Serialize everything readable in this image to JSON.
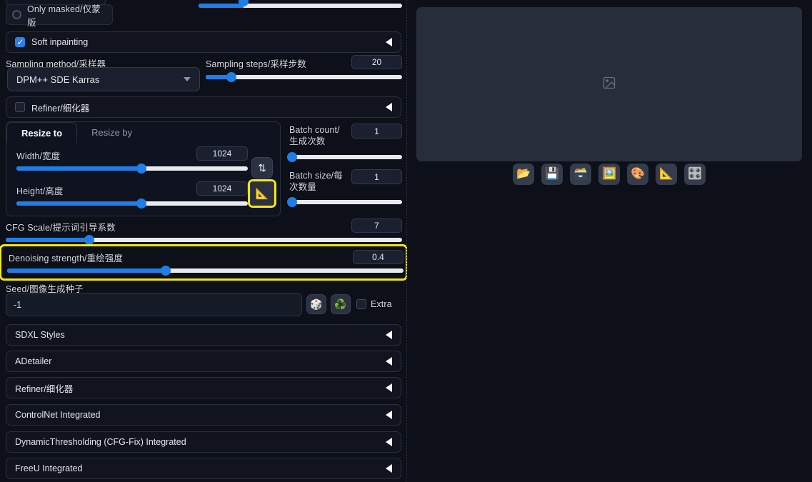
{
  "app": {
    "theme_bg": "#0b0d16",
    "accent": "#1f7fe8",
    "highlight": "#f5e712"
  },
  "left": {
    "only_masked": {
      "label": "Only masked/仅蒙版",
      "selected": false
    },
    "soft_inpainting": {
      "label": "Soft inpainting",
      "checked": true,
      "arrow": "◀"
    },
    "sampling_method": {
      "label": "Sampling method/采样器",
      "value": "DPM++ SDE Karras"
    },
    "sampling_steps": {
      "label": "Sampling steps/采样步数",
      "value": "20",
      "min": 1,
      "max": 150,
      "pct": 13
    },
    "refiner": {
      "label": "Refiner/细化器",
      "checked": false,
      "arrow": "◀"
    },
    "resize": {
      "tabs": [
        {
          "label": "Resize to",
          "active": true
        },
        {
          "label": "Resize by",
          "active": false
        }
      ],
      "width": {
        "label": "Width/宽度",
        "value": "1024",
        "pct": 54
      },
      "height": {
        "label": "Height/高度",
        "value": "1024",
        "pct": 54
      },
      "swap_button": {
        "icon": "swap-vertical-icon",
        "glyph": "⇅"
      },
      "ruler_button": {
        "icon": "triangular-ruler-icon",
        "glyph": "📐",
        "highlighted": true
      }
    },
    "batch_count": {
      "label": "Batch count/生成次数",
      "value": "1",
      "pct": 0
    },
    "batch_size": {
      "label": "Batch size/每次数量",
      "value": "1",
      "pct": 0
    },
    "cfg_scale": {
      "label": "CFG Scale/提示词引导系数",
      "value": "7",
      "pct": 21
    },
    "denoising": {
      "label": "Denoising strength/重绘强度",
      "value": "0.4",
      "pct": 40,
      "highlighted": true
    },
    "seed": {
      "label": "Seed/图像生成种子",
      "value": "-1",
      "dice_button": {
        "icon": "dice-icon",
        "glyph": "🎲"
      },
      "recycle_button": {
        "icon": "recycle-icon",
        "glyph": "♻️"
      },
      "extra": {
        "label": "Extra",
        "checked": false
      }
    },
    "accordions": [
      {
        "label": "SDXL Styles",
        "arrow": "◀"
      },
      {
        "label": "ADetailer",
        "arrow": "◀"
      },
      {
        "label": "Refiner/细化器",
        "arrow": "◀"
      },
      {
        "label": "ControlNet Integrated",
        "arrow": "◀"
      },
      {
        "label": "DynamicThresholding (CFG-Fix) Integrated",
        "arrow": "◀"
      },
      {
        "label": "FreeU Integrated",
        "arrow": "◀"
      }
    ]
  },
  "right": {
    "preview": {
      "placeholder_icon": "image-placeholder-icon"
    },
    "toolbar": [
      {
        "name": "open-folder-button",
        "glyph": "📂"
      },
      {
        "name": "save-button",
        "glyph": "💾"
      },
      {
        "name": "card-index-button",
        "glyph": "🗃️"
      },
      {
        "name": "send-to-image-button",
        "glyph": "🖼️"
      },
      {
        "name": "palette-button",
        "glyph": "🎨"
      },
      {
        "name": "ruler-button",
        "glyph": "📐"
      },
      {
        "name": "toolbox-button",
        "glyph": "🎛️"
      }
    ]
  }
}
